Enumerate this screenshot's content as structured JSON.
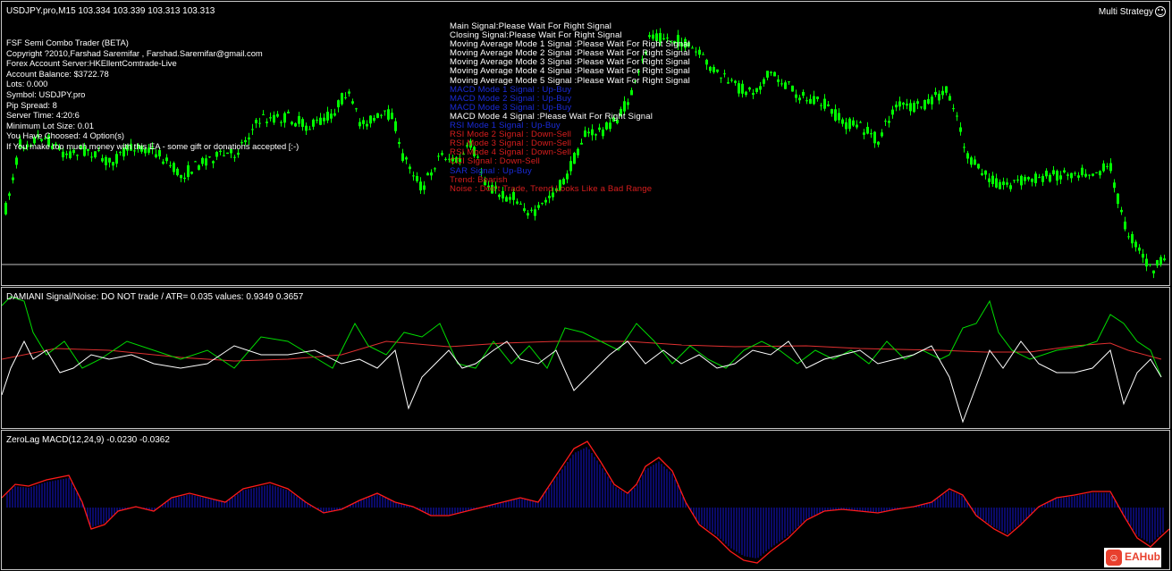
{
  "main": {
    "header": "USDJPY.pro,M15  103.334 103.339 103.313 103.313",
    "strategy_label": "Multi Strategy",
    "smiley_icon": "smiley-icon",
    "info_lines": [
      " FSF Semi Combo Trader (BETA)",
      "Copyright ?2010,Farshad Saremifar , Farshad.Saremifar@gmail.com",
      "Forex Account Server:HKEllentComtrade-Live",
      "Account Balance:  $3722.78",
      "Lots:  0.000",
      "Symbol: USDJPY.pro",
      "Pip Spread:  8",
      " Server Time: 4:20:6",
      "Minimum Lot Size: 0.01",
      "You Have Choosed: 4 Option(s)",
      "If You make too much money  with this EA - some gift or donations accepted [:-)"
    ],
    "signals": [
      {
        "text": "Main Signal:Please Wait For Right Signal",
        "color": "#ffffff"
      },
      {
        "text": "Closing Signal:Please Wait For Right Signal",
        "color": "#ffffff"
      },
      {
        "text": "Moving Average Mode 1 Signal :Please Wait For Right Signal",
        "color": "#ffffff"
      },
      {
        "text": "Moving Average Mode 2 Signal :Please Wait For Right Signal",
        "color": "#ffffff"
      },
      {
        "text": "Moving Average Mode 3 Signal :Please Wait For Right Signal",
        "color": "#ffffff"
      },
      {
        "text": "Moving Average Mode 4 Signal :Please Wait For Right Signal",
        "color": "#ffffff"
      },
      {
        "text": "Moving Average Mode 5 Signal :Please Wait For Right Signal",
        "color": "#ffffff"
      },
      {
        "text": "MACD Mode 1 Signal : Up-Buy",
        "color": "#1a2bd8"
      },
      {
        "text": "MACD Mode 2 Signal : Up-Buy",
        "color": "#1a2bd8"
      },
      {
        "text": "MACD Mode 3 Signal : Up-Buy",
        "color": "#1a2bd8"
      },
      {
        "text": "MACD Mode 4 Signal :Please Wait For Right Signal",
        "color": "#ffffff"
      },
      {
        "text": "RSI Mode 1 Signal : Up-Buy",
        "color": "#1a2bd8"
      },
      {
        "text": "RSI Mode 2 Signal : Down-Sell",
        "color": "#d81e1e"
      },
      {
        "text": "RSI Mode 3 Signal : Down-Sell",
        "color": "#d81e1e"
      },
      {
        "text": "RSI Mode 4 Signal : Down-Sell",
        "color": "#d81e1e"
      },
      {
        "text": "CCI Signal : Down-Sell",
        "color": "#d81e1e"
      },
      {
        "text": "SAR Signal : Up-Buy",
        "color": "#1a2bd8"
      },
      {
        "text": "Trend: Bearish",
        "color": "#d81e1e"
      },
      {
        "text": "Noise : Don't Trade, Trend Looks Like a Bad Range",
        "color": "#d81e1e"
      }
    ]
  },
  "damiani": {
    "header": "DAMIANI Signal/Noise: DO NOT trade  /  ATR= 0.035     values: 0.9349 0.3657"
  },
  "macd": {
    "header": "ZeroLag MACD(12,24,9) -0.0230 -0.0362"
  },
  "logo": {
    "icon": "eahub-logo-icon",
    "text": "EAHub"
  },
  "colors": {
    "candle": "#00ff00",
    "level_line": "#c0c0c0",
    "damiani_green": "#00dd00",
    "damiani_white": "#ffffff",
    "damiani_red": "#e03030",
    "histogram": "#1515d0",
    "signal_line": "#ff1a1a",
    "buy_text": "#1a2bd8",
    "sell_text": "#d81e1e"
  }
}
